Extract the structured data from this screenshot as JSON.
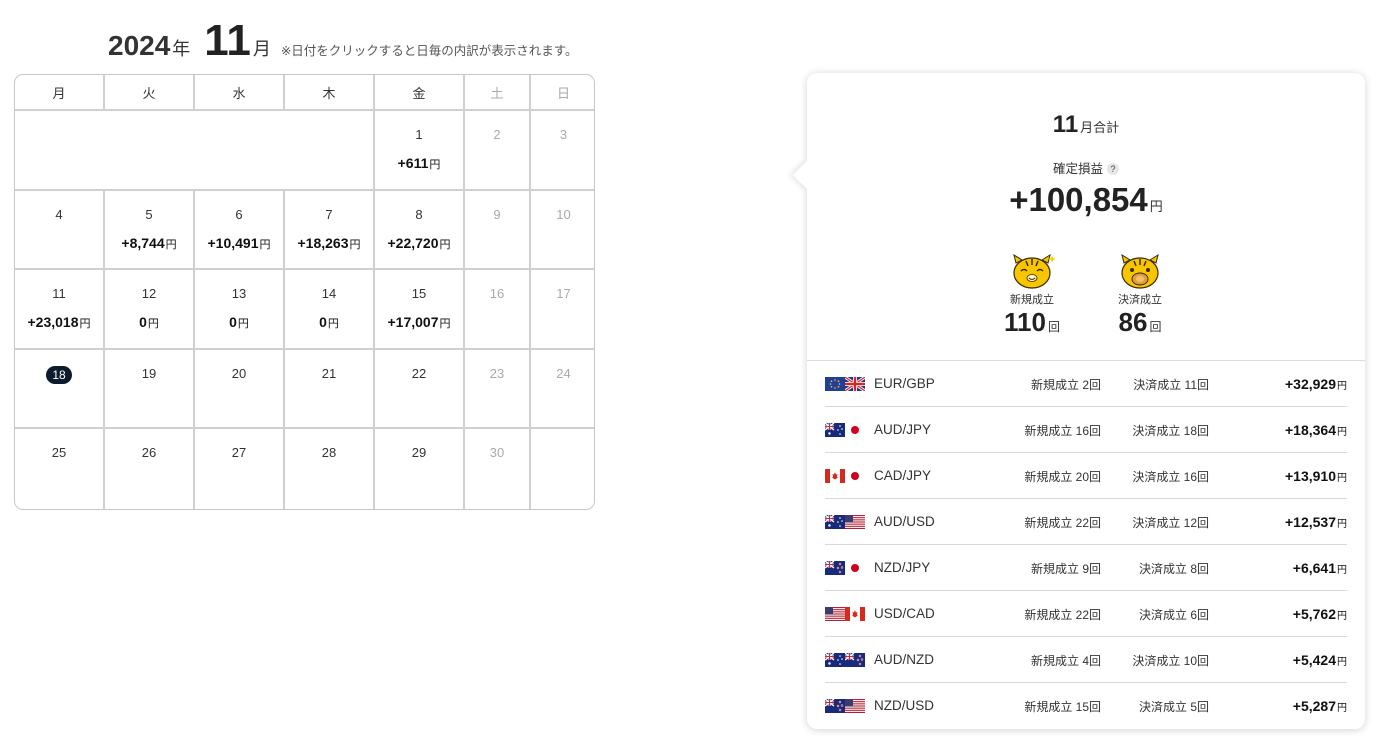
{
  "calendar": {
    "year": "2024",
    "year_unit": "年",
    "month": "11",
    "month_unit": "月",
    "note": "※日付をクリックすると日毎の内訳が表示されます。",
    "weekdays": [
      "月",
      "火",
      "水",
      "木",
      "金",
      "土",
      "日"
    ],
    "yen_symbol": "円",
    "weeks": [
      [
        {
          "day": "1",
          "amount": "+611"
        },
        {
          "day": "2",
          "amount": ""
        },
        {
          "day": "3",
          "amount": ""
        }
      ],
      [
        {
          "day": "4",
          "amount": ""
        },
        {
          "day": "5",
          "amount": "+8,744"
        },
        {
          "day": "6",
          "amount": "+10,491"
        },
        {
          "day": "7",
          "amount": "+18,263"
        },
        {
          "day": "8",
          "amount": "+22,720"
        },
        {
          "day": "9",
          "amount": ""
        },
        {
          "day": "10",
          "amount": ""
        }
      ],
      [
        {
          "day": "11",
          "amount": "+23,018"
        },
        {
          "day": "12",
          "amount": "0"
        },
        {
          "day": "13",
          "amount": "0"
        },
        {
          "day": "14",
          "amount": "0"
        },
        {
          "day": "15",
          "amount": "+17,007"
        },
        {
          "day": "16",
          "amount": ""
        },
        {
          "day": "17",
          "amount": ""
        }
      ],
      [
        {
          "day": "18",
          "amount": ""
        },
        {
          "day": "19",
          "amount": ""
        },
        {
          "day": "20",
          "amount": ""
        },
        {
          "day": "21",
          "amount": ""
        },
        {
          "day": "22",
          "amount": ""
        },
        {
          "day": "23",
          "amount": ""
        },
        {
          "day": "24",
          "amount": ""
        }
      ],
      [
        {
          "day": "25",
          "amount": ""
        },
        {
          "day": "26",
          "amount": ""
        },
        {
          "day": "27",
          "amount": ""
        },
        {
          "day": "28",
          "amount": ""
        },
        {
          "day": "29",
          "amount": ""
        },
        {
          "day": "30",
          "amount": ""
        },
        {
          "day": "",
          "amount": ""
        }
      ]
    ],
    "today_badge_color": "#0d1b2f"
  },
  "summary": {
    "month": "11",
    "month_total_label": "月合計",
    "realized_pl_label": "確定損益",
    "help_icon_char": "?",
    "realized_pl_value": "+100,854",
    "yen": "円",
    "new_label": "新規成立",
    "new_count": "110",
    "close_label": "決済成立",
    "close_count": "86",
    "count_unit": "回",
    "mascot_color": "#f7c600",
    "pairs": [
      {
        "flags": [
          "eu-flag",
          "gb-flag"
        ],
        "name": "EUR/GBP",
        "new": "新規成立 2回",
        "close": "決済成立 11回",
        "pl": "+32,929"
      },
      {
        "flags": [
          "au-flag",
          "jp-flag"
        ],
        "name": "AUD/JPY",
        "new": "新規成立 16回",
        "close": "決済成立 18回",
        "pl": "+18,364"
      },
      {
        "flags": [
          "ca-flag",
          "jp-flag"
        ],
        "name": "CAD/JPY",
        "new": "新規成立 20回",
        "close": "決済成立 16回",
        "pl": "+13,910"
      },
      {
        "flags": [
          "au-flag",
          "us-flag"
        ],
        "name": "AUD/USD",
        "new": "新規成立 22回",
        "close": "決済成立 12回",
        "pl": "+12,537"
      },
      {
        "flags": [
          "nz-flag",
          "jp-flag"
        ],
        "name": "NZD/JPY",
        "new": "新規成立 9回",
        "close": "決済成立 8回",
        "pl": "+6,641"
      },
      {
        "flags": [
          "us-flag",
          "ca-flag"
        ],
        "name": "USD/CAD",
        "new": "新規成立 22回",
        "close": "決済成立 6回",
        "pl": "+5,762"
      },
      {
        "flags": [
          "au-flag",
          "nz-flag"
        ],
        "name": "AUD/NZD",
        "new": "新規成立 4回",
        "close": "決済成立 10回",
        "pl": "+5,424"
      },
      {
        "flags": [
          "nz-flag",
          "us-flag"
        ],
        "name": "NZD/USD",
        "new": "新規成立 15回",
        "close": "決済成立 5回",
        "pl": "+5,287"
      }
    ]
  }
}
